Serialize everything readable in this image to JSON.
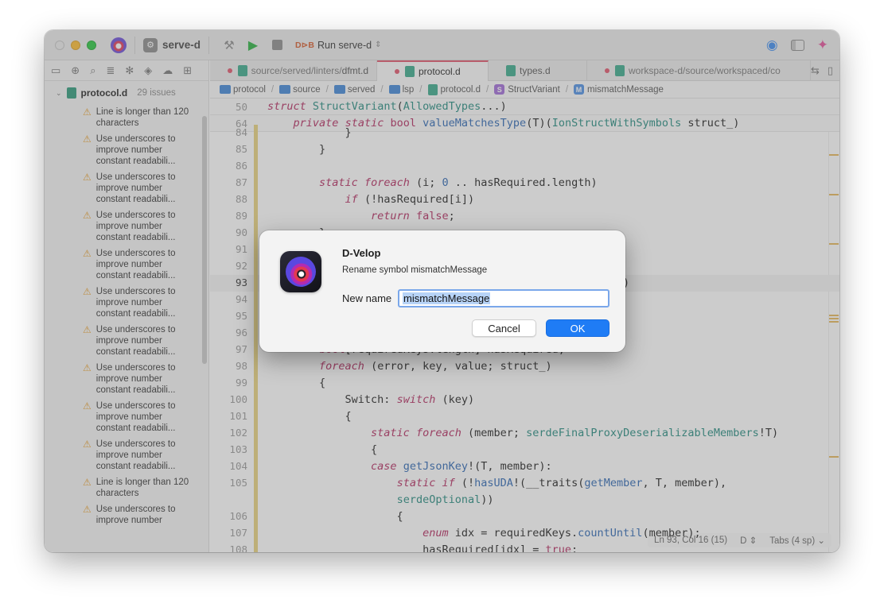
{
  "toolbar": {
    "project": "serve-d",
    "scheme_badge": "D⊳B",
    "scheme": "Run serve-d"
  },
  "tabs": [
    {
      "path": "source/served/linters/",
      "file": "dfmt.d",
      "modified": true
    },
    {
      "path": "",
      "file": "protocol.d",
      "modified": true,
      "active": true
    },
    {
      "path": "",
      "file": "types.d",
      "modified": false
    },
    {
      "path": "workspace-d/source/workspaced/co",
      "file": "",
      "modified": true
    }
  ],
  "breadcrumb": [
    "protocol",
    "source",
    "served",
    "lsp",
    "protocol.d",
    "StructVariant",
    "mismatchMessage"
  ],
  "sidebar": {
    "file": "protocol.d",
    "count": "29 issues",
    "issues": [
      "Line is longer than 120 characters",
      "Use underscores to improve number constant readabili...",
      "Use underscores to improve number constant readabili...",
      "Use underscores to improve number constant readabili...",
      "Use underscores to improve number constant readabili...",
      "Use underscores to improve number constant readabili...",
      "Use underscores to improve number constant readabili...",
      "Use underscores to improve number constant readabili...",
      "Use underscores to improve number constant readabili...",
      "Use underscores to improve number constant readabili...",
      "Line is longer than 120 characters",
      "Use underscores to improve number"
    ]
  },
  "editor": {
    "sticky": [
      {
        "ln": "50",
        "code": "struct StructVariant(AllowedTypes...)"
      },
      {
        "ln": "64",
        "code": "    private static bool valueMatchesType(T)(IonStructWithSymbols struct_)"
      }
    ],
    "lines": [
      {
        "ln": "84",
        "code": "            }"
      },
      {
        "ln": "85",
        "code": "        }"
      },
      {
        "ln": "86",
        "code": ""
      },
      {
        "ln": "87",
        "code": "        static foreach (i; 0 .. hasRequired.length)"
      },
      {
        "ln": "88",
        "code": "            if (!hasRequired[i])"
      },
      {
        "ln": "89",
        "code": "                return false;"
      },
      {
        "ln": "90",
        "code": "        }"
      },
      {
        "ln": "91",
        "code": ""
      },
      {
        "ln": "92",
        "code": ""
      },
      {
        "ln": "93",
        "code": "                                           bols struct_)"
      },
      {
        "ln": "94",
        "code": ""
      },
      {
        "ln": "95",
        "code": ""
      },
      {
        "ln": "96",
        "code": ""
      },
      {
        "ln": "97",
        "code": "        bool[requiredKeys.length] hasRequired;"
      },
      {
        "ln": "98",
        "code": "        foreach (error, key, value; struct_)"
      },
      {
        "ln": "99",
        "code": "        {"
      },
      {
        "ln": "100",
        "code": "            Switch: switch (key)"
      },
      {
        "ln": "101",
        "code": "            {"
      },
      {
        "ln": "102",
        "code": "                static foreach (member; serdeFinalProxyDeserializableMembers!T)"
      },
      {
        "ln": "103",
        "code": "                {"
      },
      {
        "ln": "104",
        "code": "                case getJsonKey!(T, member):"
      },
      {
        "ln": "105",
        "code": "                    static if (!hasUDA!(__traits(getMember, T, member),"
      },
      {
        "ln": "",
        "code": "                    serdeOptional))"
      },
      {
        "ln": "106",
        "code": "                    {"
      },
      {
        "ln": "107",
        "code": "                        enum idx = requiredKeys.countUntil(member);"
      },
      {
        "ln": "108",
        "code": "                        hasRequired[idx] = true;"
      }
    ]
  },
  "status": {
    "position": "Ln 93, Col 16 (15)",
    "language": "D",
    "indent": "Tabs (4 sp)"
  },
  "dialog": {
    "title": "D-Velop",
    "message": "Rename symbol mismatchMessage",
    "field_label": "New name",
    "field_value": "mismatchMessage",
    "cancel": "Cancel",
    "ok": "OK"
  }
}
